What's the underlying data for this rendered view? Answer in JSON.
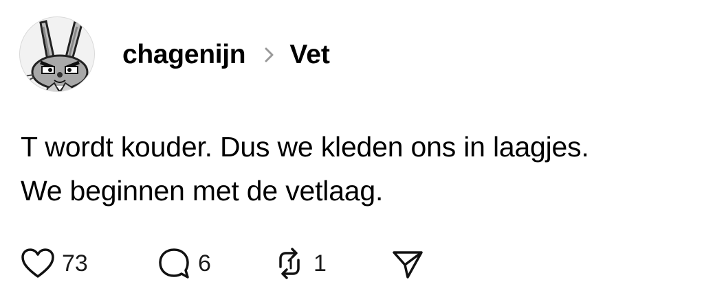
{
  "post": {
    "author": "chagenijn",
    "topic": "Vet",
    "text_lines": [
      "T wordt kouder. Dus we kleden ons in laagjes.",
      "We beginnen met de vetlaag."
    ],
    "actions": {
      "likes": "73",
      "replies": "6",
      "reposts": "1"
    }
  },
  "icons": {
    "avatar": "grumpy-bunny-avatar",
    "separator": "chevron-right-icon",
    "like": "heart-icon",
    "reply": "comment-bubble-icon",
    "repost": "repost-icon",
    "share": "send-icon"
  },
  "colors": {
    "text": "#000000",
    "separator": "#999999",
    "icon_stroke": "#111111"
  }
}
